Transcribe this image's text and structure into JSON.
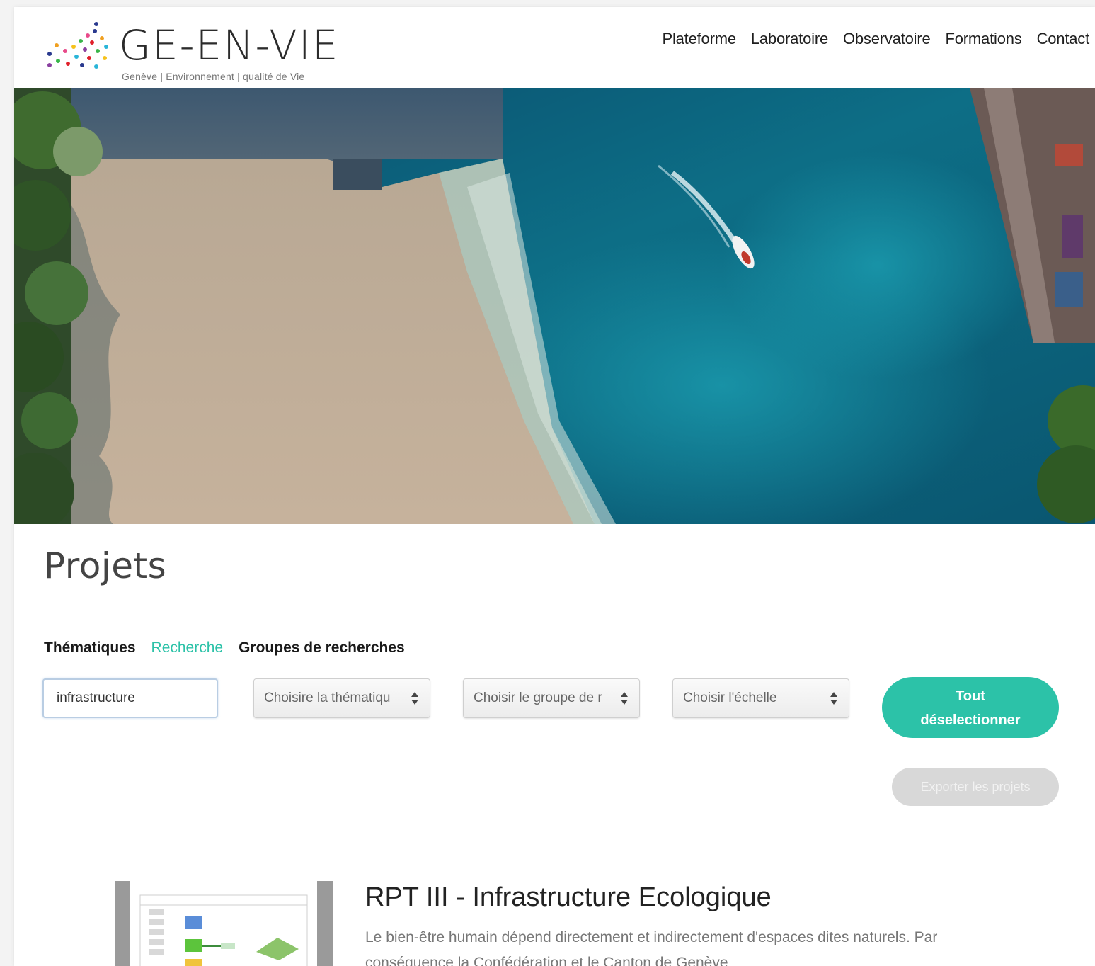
{
  "brand": {
    "title": "GE-EN-VIE",
    "subtitle": "Genève | Environnement | qualité de Vie"
  },
  "nav": {
    "items": [
      "Plateforme",
      "Laboratoire",
      "Observatoire",
      "Formations",
      "Contact"
    ]
  },
  "page": {
    "title": "Projets"
  },
  "tabs": {
    "items": [
      "Thématiques",
      "Recherche",
      "Groupes de recherches"
    ],
    "active": "Recherche"
  },
  "filters": {
    "search_value": "infrastructure",
    "select_thematique": "Choisire la thématiqu",
    "select_groupe": "Choisir le groupe de r",
    "select_echelle": "Choisir l'échelle",
    "deselect_line1": "Tout",
    "deselect_line2": "déselectionner",
    "export_label": "Exporter les projets"
  },
  "project": {
    "title": "RPT III - Infrastructure Ecologique",
    "description": "Le bien-être humain dépend directement et indirectement d'espaces dites naturels. Par conséquence la Confédération et le Canton de Genève"
  },
  "colors": {
    "accent": "#2cc2a8",
    "export_disabled": "#d8d8d8"
  }
}
